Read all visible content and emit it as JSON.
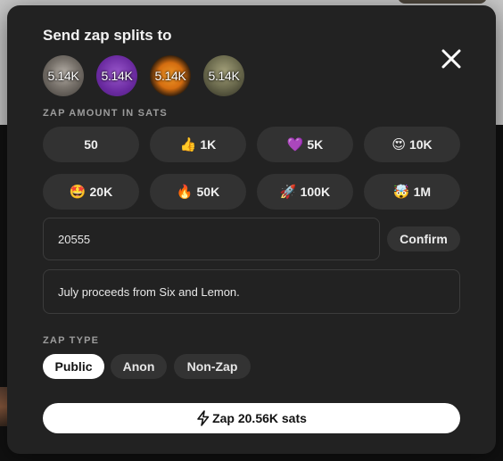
{
  "modal": {
    "title": "Send zap splits to",
    "close_icon": "close-icon",
    "recipients": [
      {
        "amount": "5.14K"
      },
      {
        "amount": "5.14K"
      },
      {
        "amount": "5.14K"
      },
      {
        "amount": "5.14K"
      }
    ],
    "amount_section_label": "ZAP AMOUNT IN SATS",
    "amount_options": [
      {
        "emoji": "",
        "label": "50"
      },
      {
        "emoji": "👍",
        "label": "1K"
      },
      {
        "emoji": "💜",
        "label": "5K"
      },
      {
        "emoji": "😍",
        "label": "10K"
      },
      {
        "emoji": "🤩",
        "label": "20K"
      },
      {
        "emoji": "🔥",
        "label": "50K"
      },
      {
        "emoji": "🚀",
        "label": "100K"
      },
      {
        "emoji": "🤯",
        "label": "1M"
      }
    ],
    "custom_amount_value": "20555",
    "confirm_label": "Confirm",
    "comment_value": "July proceeds from Six and Lemon.",
    "type_section_label": "ZAP TYPE",
    "zap_types": [
      {
        "label": "Public",
        "selected": true
      },
      {
        "label": "Anon",
        "selected": false
      },
      {
        "label": "Non-Zap",
        "selected": false
      }
    ],
    "zap_button_label": "Zap 20.56K sats",
    "zap_button_icon": "lightning-icon"
  }
}
